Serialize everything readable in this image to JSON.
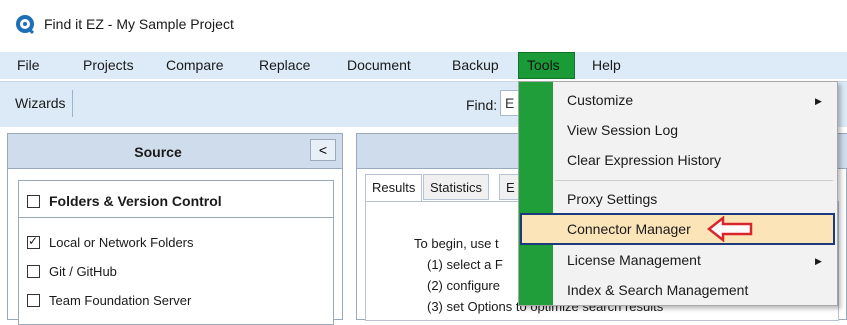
{
  "window": {
    "title": "Find it EZ - My Sample Project"
  },
  "menubar": {
    "items": [
      {
        "label": "File"
      },
      {
        "label": "Projects"
      },
      {
        "label": "Compare"
      },
      {
        "label": "Replace"
      },
      {
        "label": "Document"
      },
      {
        "label": "Backup"
      },
      {
        "label": "Tools"
      },
      {
        "label": "Help"
      }
    ]
  },
  "toolbar": {
    "wizards_label": "Wizards",
    "find_label": "Find:",
    "find_value": "E"
  },
  "source": {
    "title": "Source",
    "collapse_label": "<",
    "group_title": "Folders & Version Control",
    "options": [
      {
        "label": "Local or Network Folders",
        "checked": true
      },
      {
        "label": "Git / GitHub",
        "checked": false
      },
      {
        "label": "Team Foundation Server",
        "checked": false
      }
    ]
  },
  "results": {
    "tabs": [
      {
        "label": "Results"
      },
      {
        "label": "Statistics"
      },
      {
        "label": "E"
      }
    ],
    "lines": [
      "To begin, use t",
      "(1) select a F",
      "(2) configure",
      "(3) set Options to optimize search results"
    ],
    "overflow_char": "n"
  },
  "tools_menu": {
    "items": [
      {
        "label": "Customize",
        "submenu": true
      },
      {
        "label": "View Session Log"
      },
      {
        "label": "Clear Expression History"
      },
      {
        "label": "Proxy Settings"
      },
      {
        "label": "Connector Manager",
        "highlighted": true
      },
      {
        "label": "License Management",
        "submenu": true
      },
      {
        "label": "Index & Search Management"
      }
    ]
  },
  "colors": {
    "menubar_bg": "#ddeaf8",
    "tools_active": "#1a9b38",
    "highlight_bg": "#fbe4b8",
    "highlight_border": "#1e3a7e",
    "arrow_red": "#d9262a"
  }
}
